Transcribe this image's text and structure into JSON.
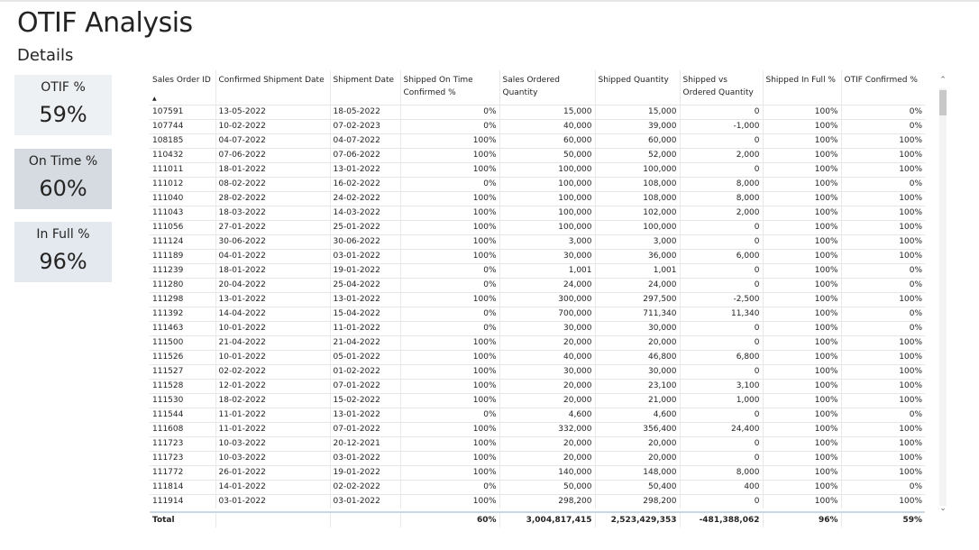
{
  "page": {
    "title": "OTIF Analysis",
    "subtitle": "Details"
  },
  "cards": [
    {
      "label": "OTIF %",
      "value": "59%"
    },
    {
      "label": "On Time %",
      "value": "60%"
    },
    {
      "label": "In Full %",
      "value": "96%"
    }
  ],
  "table": {
    "columns": [
      "Sales Order ID",
      "Confirmed Shipment Date",
      "Shipment Date",
      "Shipped On Time Confirmed %",
      "Sales Ordered Quantity",
      "Shipped Quantity",
      "Shipped vs Ordered Quantity",
      "Shipped In Full %",
      "OTIF Confirmed %"
    ],
    "rows": [
      [
        "107591",
        "13-05-2022",
        "18-05-2022",
        "0%",
        "15,000",
        "15,000",
        "0",
        "100%",
        "0%"
      ],
      [
        "107744",
        "10-02-2022",
        "07-02-2023",
        "0%",
        "40,000",
        "39,000",
        "-1,000",
        "100%",
        "0%"
      ],
      [
        "108185",
        "04-07-2022",
        "04-07-2022",
        "100%",
        "60,000",
        "60,000",
        "0",
        "100%",
        "100%"
      ],
      [
        "110432",
        "07-06-2022",
        "07-06-2022",
        "100%",
        "50,000",
        "52,000",
        "2,000",
        "100%",
        "100%"
      ],
      [
        "111011",
        "18-01-2022",
        "13-01-2022",
        "100%",
        "100,000",
        "100,000",
        "0",
        "100%",
        "100%"
      ],
      [
        "111012",
        "08-02-2022",
        "16-02-2022",
        "0%",
        "100,000",
        "108,000",
        "8,000",
        "100%",
        "0%"
      ],
      [
        "111040",
        "28-02-2022",
        "24-02-2022",
        "100%",
        "100,000",
        "108,000",
        "8,000",
        "100%",
        "100%"
      ],
      [
        "111043",
        "18-03-2022",
        "14-03-2022",
        "100%",
        "100,000",
        "102,000",
        "2,000",
        "100%",
        "100%"
      ],
      [
        "111056",
        "27-01-2022",
        "25-01-2022",
        "100%",
        "100,000",
        "100,000",
        "0",
        "100%",
        "100%"
      ],
      [
        "111124",
        "30-06-2022",
        "30-06-2022",
        "100%",
        "3,000",
        "3,000",
        "0",
        "100%",
        "100%"
      ],
      [
        "111189",
        "04-01-2022",
        "03-01-2022",
        "100%",
        "30,000",
        "36,000",
        "6,000",
        "100%",
        "100%"
      ],
      [
        "111239",
        "18-01-2022",
        "19-01-2022",
        "0%",
        "1,001",
        "1,001",
        "0",
        "100%",
        "0%"
      ],
      [
        "111280",
        "20-04-2022",
        "25-04-2022",
        "0%",
        "24,000",
        "24,000",
        "0",
        "100%",
        "0%"
      ],
      [
        "111298",
        "13-01-2022",
        "13-01-2022",
        "100%",
        "300,000",
        "297,500",
        "-2,500",
        "100%",
        "100%"
      ],
      [
        "111392",
        "14-04-2022",
        "15-04-2022",
        "0%",
        "700,000",
        "711,340",
        "11,340",
        "100%",
        "0%"
      ],
      [
        "111463",
        "10-01-2022",
        "11-01-2022",
        "0%",
        "30,000",
        "30,000",
        "0",
        "100%",
        "0%"
      ],
      [
        "111500",
        "21-04-2022",
        "21-04-2022",
        "100%",
        "20,000",
        "20,000",
        "0",
        "100%",
        "100%"
      ],
      [
        "111526",
        "10-01-2022",
        "05-01-2022",
        "100%",
        "40,000",
        "46,800",
        "6,800",
        "100%",
        "100%"
      ],
      [
        "111527",
        "02-02-2022",
        "01-02-2022",
        "100%",
        "30,000",
        "30,000",
        "0",
        "100%",
        "100%"
      ],
      [
        "111528",
        "12-01-2022",
        "07-01-2022",
        "100%",
        "20,000",
        "23,100",
        "3,100",
        "100%",
        "100%"
      ],
      [
        "111530",
        "18-02-2022",
        "15-02-2022",
        "100%",
        "20,000",
        "21,000",
        "1,000",
        "100%",
        "100%"
      ],
      [
        "111544",
        "11-01-2022",
        "13-01-2022",
        "0%",
        "4,600",
        "4,600",
        "0",
        "100%",
        "0%"
      ],
      [
        "111608",
        "11-01-2022",
        "07-01-2022",
        "100%",
        "332,000",
        "356,400",
        "24,400",
        "100%",
        "100%"
      ],
      [
        "111723",
        "10-03-2022",
        "20-12-2021",
        "100%",
        "20,000",
        "20,000",
        "0",
        "100%",
        "100%"
      ],
      [
        "111723",
        "10-03-2022",
        "03-01-2022",
        "100%",
        "20,000",
        "20,000",
        "0",
        "100%",
        "100%"
      ],
      [
        "111772",
        "26-01-2022",
        "19-01-2022",
        "100%",
        "140,000",
        "148,000",
        "8,000",
        "100%",
        "100%"
      ],
      [
        "111814",
        "14-01-2022",
        "02-02-2022",
        "0%",
        "50,000",
        "50,400",
        "400",
        "100%",
        "0%"
      ],
      [
        "111914",
        "03-01-2022",
        "03-01-2022",
        "100%",
        "298,200",
        "298,200",
        "0",
        "100%",
        "100%"
      ]
    ],
    "total": [
      "Total",
      "",
      "",
      "60%",
      "3,004,817,415",
      "2,523,429,353",
      "-481,388,062",
      "96%",
      "59%"
    ]
  },
  "icons": {
    "sort": "sort-ascending-icon",
    "scroll_up": "chevron-up-icon",
    "scroll_down": "chevron-down-icon"
  }
}
